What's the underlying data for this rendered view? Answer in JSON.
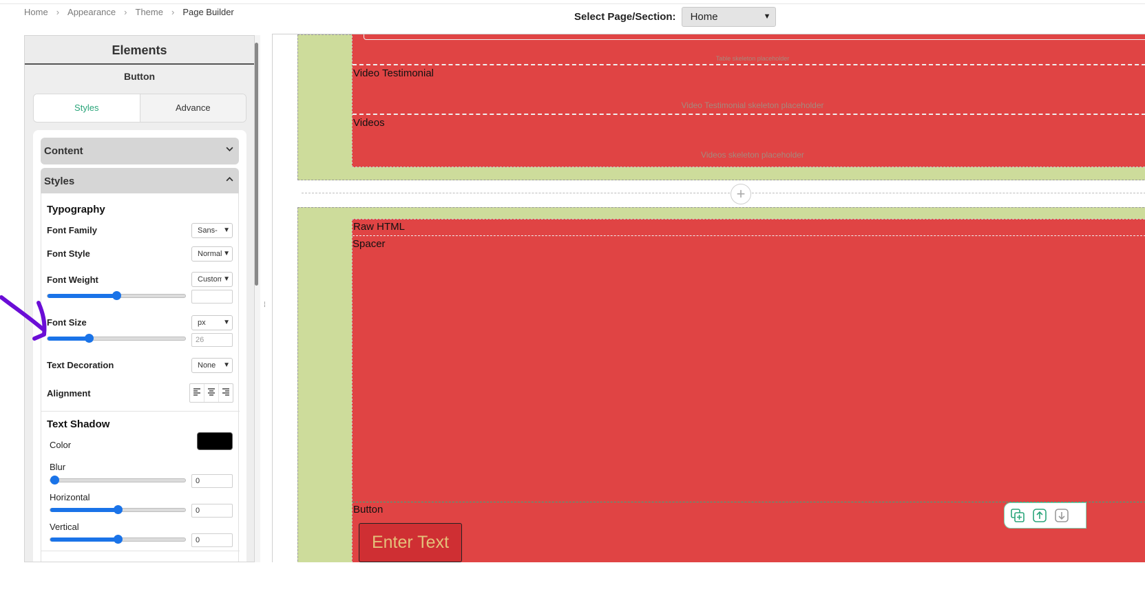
{
  "breadcrumb": [
    "Home",
    "Appearance",
    "Theme",
    "Page Builder"
  ],
  "page_select": {
    "label": "Select Page/Section:",
    "value": "Home"
  },
  "panel": {
    "title": "Elements",
    "subtitle": "Button",
    "tabs": [
      "Styles",
      "Advance"
    ],
    "active_tab": "Styles",
    "accordions": {
      "content": "Content",
      "styles": "Styles"
    },
    "typography": {
      "title": "Typography",
      "font_family": {
        "label": "Font Family",
        "value": "Sans-Serif"
      },
      "font_style": {
        "label": "Font Style",
        "value": "Normal"
      },
      "font_weight": {
        "label": "Font Weight",
        "value": "Custom",
        "slider": 0.5,
        "input": ""
      },
      "font_size": {
        "label": "Font Size",
        "unit": "px",
        "slider": 0.3,
        "input": "26"
      },
      "text_decoration": {
        "label": "Text Decoration",
        "value": "None"
      },
      "alignment": {
        "label": "Alignment",
        "options": [
          "align-left-icon",
          "align-center-icon",
          "align-right-icon"
        ]
      }
    },
    "text_shadow": {
      "title": "Text Shadow",
      "color": {
        "label": "Color",
        "value": "#000000"
      },
      "blur": {
        "label": "Blur",
        "slider": 0.0,
        "input": "0"
      },
      "horizontal": {
        "label": "Horizontal",
        "slider": 0.5,
        "input": "0"
      },
      "vertical": {
        "label": "Vertical",
        "slider": 0.5,
        "input": "0"
      }
    }
  },
  "canvas": {
    "section1": {
      "skel_top": "Table skeleton placeholder",
      "video_testimonial": {
        "label": "Video Testimonial",
        "skeleton": "Video Testimonial skeleton placeholder"
      },
      "videos": {
        "label": "Videos",
        "skeleton": "Videos skeleton placeholder"
      }
    },
    "add_section": "+",
    "section2": {
      "raw_html": "Raw HTML",
      "spacer": "Spacer",
      "button": {
        "label": "Button",
        "text": "Enter Text"
      }
    },
    "toolbar": [
      "duplicate-icon",
      "move-up-icon",
      "move-down-icon"
    ]
  },
  "colors": {
    "accent": "#2aa57a",
    "red_block": "#e04444",
    "section_bg": "#cddc9b",
    "slider": "#1a73e8",
    "annotation": "#6a0dd6"
  }
}
